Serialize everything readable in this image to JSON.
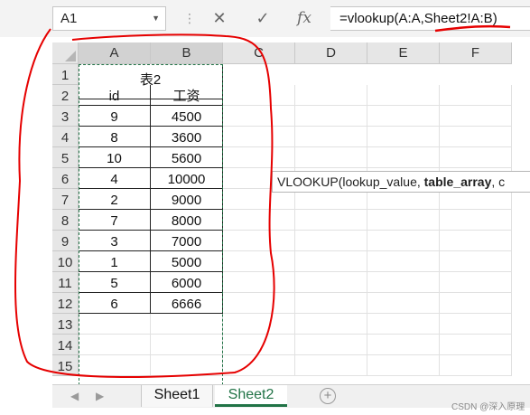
{
  "namebox": {
    "value": "A1"
  },
  "formula_bar": {
    "cancel_icon": "✕",
    "confirm_icon": "✓",
    "fx_label": "fx",
    "formula": "=vlookup(A:A,Sheet2!A:B)"
  },
  "columns": [
    "A",
    "B",
    "C",
    "D",
    "E",
    "F"
  ],
  "rows": [
    "1",
    "2",
    "3",
    "4",
    "5",
    "6",
    "7",
    "8",
    "9",
    "10",
    "11",
    "12",
    "13",
    "14",
    "15"
  ],
  "table": {
    "title": "表2",
    "headers": [
      "id",
      "工资"
    ],
    "rows": [
      [
        "9",
        "4500"
      ],
      [
        "8",
        "3600"
      ],
      [
        "10",
        "5600"
      ],
      [
        "4",
        "10000"
      ],
      [
        "2",
        "9000"
      ],
      [
        "7",
        "8000"
      ],
      [
        "3",
        "7000"
      ],
      [
        "1",
        "5000"
      ],
      [
        "5",
        "6000"
      ],
      [
        "6",
        "6666"
      ]
    ]
  },
  "tooltip": {
    "prefix": "VLOOKUP(lookup_value, ",
    "bold": "table_array",
    "suffix": ", c"
  },
  "sheets": [
    {
      "name": "Sheet1",
      "active": false
    },
    {
      "name": "Sheet2",
      "active": true
    }
  ],
  "add_sheet_label": "+",
  "watermark": "CSDN @深入原理",
  "colors": {
    "accent": "#217346",
    "annotation": "#e60000"
  }
}
